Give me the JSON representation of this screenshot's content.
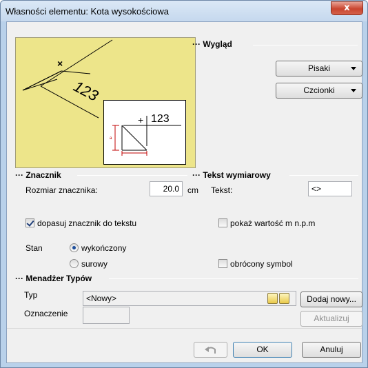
{
  "window": {
    "title": "Własności elementu: Kota wysokościowa",
    "close_glyph": "x"
  },
  "preview": {
    "marker_text": "123",
    "inset_value": "123",
    "inset_plus": "+",
    "small_letter": "a"
  },
  "wyglad": {
    "label": "Wygląd",
    "pens_button": "Pisaki",
    "fonts_button": "Czcionki"
  },
  "znacznik": {
    "label": "Znacznik",
    "size_label": "Rozmiar znacznika:",
    "size_value": "20.0",
    "size_unit": "cm",
    "fit_checkbox_label": "dopasuj znacznik do tekstu",
    "fit_checked": true,
    "state_label": "Stan",
    "state_finished": "wykończony",
    "state_raw": "surowy",
    "selected_state": "wykończony"
  },
  "tekst": {
    "label": "Tekst wymiarowy",
    "text_label": "Tekst:",
    "text_value": "<>",
    "show_value_label": "pokaż wartość m n.p.m",
    "show_value_checked": false,
    "reversed_label": "obrócony symbol",
    "reversed_checked": false
  },
  "menadzer": {
    "label": "Menadżer Typów",
    "type_label": "Typ",
    "type_value": "<Nowy>",
    "add_button": "Dodaj nowy...",
    "designation_label": "Oznaczenie",
    "designation_value": "",
    "update_button": "Aktualizuj"
  },
  "footer": {
    "ok": "OK",
    "cancel": "Anuluj"
  },
  "icons": {
    "undo": "undo-icon",
    "type_edit": "edit-type-icon",
    "type_lock": "lock-type-icon"
  },
  "colors": {
    "preview_bg": "#ede58a",
    "close_button": "#c9452f",
    "marker_red": "#c00000"
  }
}
